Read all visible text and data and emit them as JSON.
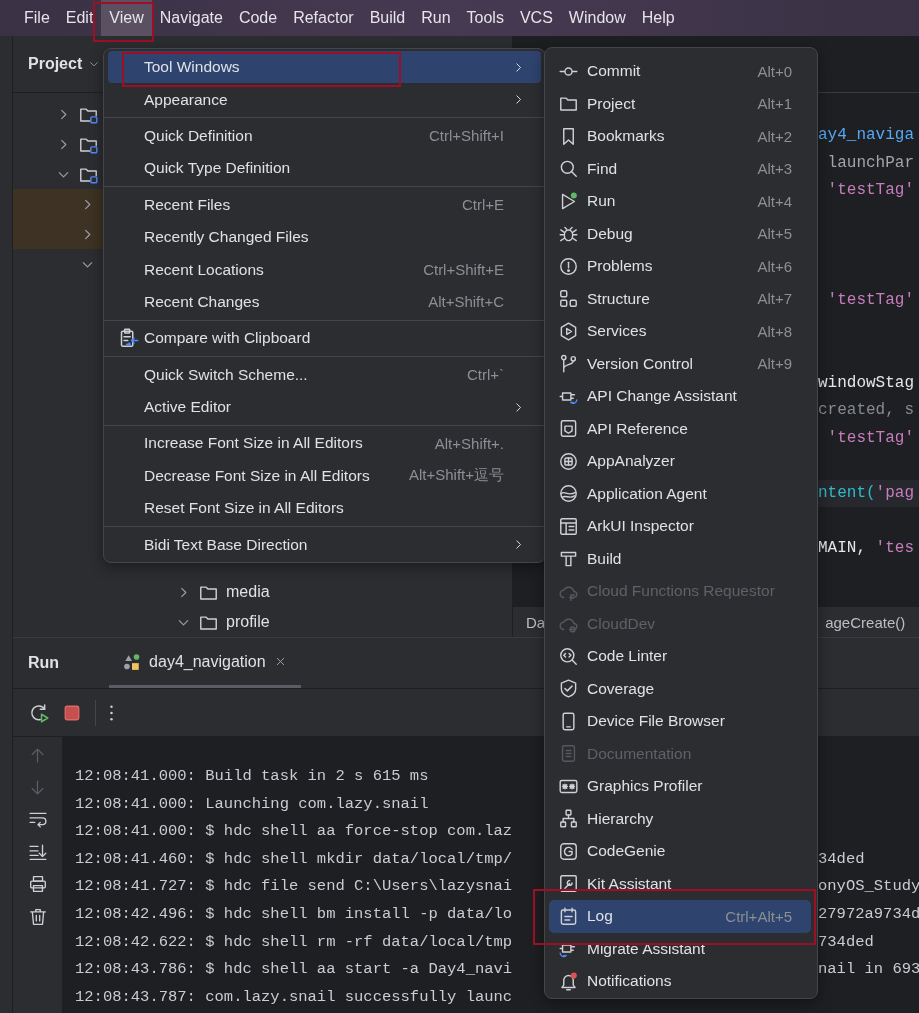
{
  "menubar": [
    {
      "label": "File",
      "selected": false,
      "outlined": false
    },
    {
      "label": "Edit",
      "selected": false,
      "outlined": false
    },
    {
      "label": "View",
      "selected": true,
      "outlined": true
    },
    {
      "label": "Navigate",
      "selected": false,
      "outlined": false
    },
    {
      "label": "Code",
      "selected": false,
      "outlined": false
    },
    {
      "label": "Refactor",
      "selected": false,
      "outlined": false
    },
    {
      "label": "Build",
      "selected": false,
      "outlined": false
    },
    {
      "label": "Run",
      "selected": false,
      "outlined": false
    },
    {
      "label": "Tools",
      "selected": false,
      "outlined": false
    },
    {
      "label": "VCS",
      "selected": false,
      "outlined": false
    },
    {
      "label": "Window",
      "selected": false,
      "outlined": false
    },
    {
      "label": "Help",
      "selected": false,
      "outlined": false
    }
  ],
  "project_panel": {
    "title": "Project",
    "tree": [
      {
        "kind": "module",
        "expanded": false,
        "highlighted": false
      },
      {
        "kind": "module",
        "expanded": false,
        "highlighted": false
      },
      {
        "kind": "module",
        "expanded": true,
        "highlighted": false,
        "children": [
          {
            "expanded": false,
            "highlighted": true
          },
          {
            "expanded": false,
            "highlighted": true
          },
          {
            "expanded": true,
            "highlighted": false,
            "children": [
              {
                "children": [
                  {
                    "children": [
                      {
                        "children": [
                          {
                            "label": "media",
                            "kind": "folder",
                            "expanded": false,
                            "highlighted": false
                          },
                          {
                            "label": "profile",
                            "kind": "folder",
                            "expanded": true,
                            "highlighted": false
                          }
                        ]
                      }
                    ]
                  }
                ]
              }
            ]
          }
        ]
      }
    ]
  },
  "editor": {
    "code_lines": [
      {
        "kind": "code",
        "highlighted": false,
        "tokens": [
          {
            "text": "ay4_naviga",
            "kind": "ident"
          }
        ]
      },
      {
        "kind": "code",
        "highlighted": false,
        "tokens": [
          {
            "text": " launchPar",
            "kind": "param"
          }
        ]
      },
      {
        "kind": "code",
        "highlighted": false,
        "tokens": [
          {
            "text": " 'testTag'",
            "kind": "string"
          }
        ]
      },
      {
        "kind": "blank",
        "highlighted": false
      },
      {
        "kind": "blank",
        "highlighted": false
      },
      {
        "kind": "blank",
        "highlighted": false
      },
      {
        "kind": "code",
        "highlighted": false,
        "tokens": [
          {
            "text": " 'testTag'",
            "kind": "string"
          }
        ]
      },
      {
        "kind": "blank",
        "highlighted": false
      },
      {
        "kind": "blank",
        "highlighted": false
      },
      {
        "kind": "code",
        "highlighted": false,
        "tokens": [
          {
            "text": "windowStag",
            "kind": "plain"
          }
        ]
      },
      {
        "kind": "code",
        "highlighted": false,
        "tokens": [
          {
            "text": "created, s",
            "kind": "muted"
          }
        ]
      },
      {
        "kind": "code",
        "highlighted": false,
        "tokens": [
          {
            "text": " 'testTag'",
            "kind": "string"
          }
        ]
      },
      {
        "kind": "blank",
        "highlighted": false
      },
      {
        "kind": "code",
        "highlighted": true,
        "tokens": [
          {
            "text": "ntent(",
            "kind": "method"
          },
          {
            "text": "'pag",
            "kind": "string"
          }
        ]
      },
      {
        "kind": "blank",
        "highlighted": false
      },
      {
        "kind": "code",
        "highlighted": false,
        "tokens": [
          {
            "text": "MAIN, ",
            "kind": "plain"
          },
          {
            "text": "'tes",
            "kind": "string"
          }
        ]
      }
    ],
    "breadcrumb": {
      "start": "Da",
      "end": "ageCreate()"
    }
  },
  "run_panel": {
    "title": "Run",
    "tabs": [
      {
        "label": "day4_navigation",
        "selected": true
      }
    ],
    "console": [
      {
        "text": "12:08:41.000: Build task in 2 s 615 ms"
      },
      {
        "text": "12:08:41.000: Launching com.lazy.snail"
      },
      {
        "text": "12:08:41.000: $ hdc shell aa force-stop com.laz"
      },
      {
        "text": "12:08:41.460: $ hdc shell mkdir data/local/tmp/",
        "tail": "34ded"
      },
      {
        "text": "12:08:41.727: $ hdc file send C:\\Users\\lazysnai",
        "tail": "onyOS_Study"
      },
      {
        "text": "12:08:42.496: $ hdc shell bm install -p data/lo",
        "tail": "27972a9734d"
      },
      {
        "text": "12:08:42.622: $ hdc shell rm -rf data/local/tmp",
        "tail": "734ded"
      },
      {
        "text": "12:08:43.786: $ hdc shell aa start -a Day4_navi",
        "tail": "nail in 693"
      },
      {
        "text": "12:08:43.787: com.lazy.snail successfully launc"
      }
    ]
  },
  "view_menu": {
    "sections": [
      {
        "items": [
          {
            "label": "Tool Windows",
            "kind": "plain",
            "submenu": true,
            "selected": true,
            "outlined": true
          },
          {
            "label": "Appearance",
            "kind": "plain",
            "submenu": true,
            "selected": false,
            "outlined": false
          }
        ]
      },
      {
        "items": [
          {
            "label": "Quick Definition",
            "kind": "plain",
            "shortcut": "Ctrl+Shift+I",
            "submenu": false,
            "selected": false,
            "outlined": false
          },
          {
            "label": "Quick Type Definition",
            "kind": "plain",
            "submenu": false,
            "selected": false,
            "outlined": false
          }
        ]
      },
      {
        "items": [
          {
            "label": "Recent Files",
            "kind": "plain",
            "shortcut": "Ctrl+E",
            "submenu": false,
            "selected": false,
            "outlined": false
          },
          {
            "label": "Recently Changed Files",
            "kind": "plain",
            "submenu": false,
            "selected": false,
            "outlined": false
          },
          {
            "label": "Recent Locations",
            "kind": "plain",
            "shortcut": "Ctrl+Shift+E",
            "submenu": false,
            "selected": false,
            "outlined": false
          },
          {
            "label": "Recent Changes",
            "kind": "plain",
            "shortcut": "Alt+Shift+C",
            "submenu": false,
            "selected": false,
            "outlined": false
          }
        ]
      },
      {
        "items": [
          {
            "label": "Compare with Clipboard",
            "kind": "with-icon",
            "submenu": false,
            "selected": false,
            "outlined": false
          }
        ]
      },
      {
        "items": [
          {
            "label": "Quick Switch Scheme...",
            "kind": "plain",
            "shortcut": "Ctrl+`",
            "submenu": false,
            "selected": false,
            "outlined": false
          },
          {
            "label": "Active Editor",
            "kind": "plain",
            "submenu": true,
            "selected": false,
            "outlined": false
          }
        ]
      },
      {
        "items": [
          {
            "label": "Increase Font Size in All Editors",
            "kind": "plain",
            "shortcut": "Alt+Shift+.",
            "submenu": false,
            "selected": false,
            "outlined": false
          },
          {
            "label": "Decrease Font Size in All Editors",
            "kind": "plain",
            "shortcut": "Alt+Shift+逗号",
            "submenu": false,
            "selected": false,
            "outlined": false
          },
          {
            "label": "Reset Font Size in All Editors",
            "kind": "plain",
            "submenu": false,
            "selected": false,
            "outlined": false
          }
        ]
      },
      {
        "items": [
          {
            "label": "Bidi Text Base Direction",
            "kind": "plain",
            "submenu": true,
            "selected": false,
            "outlined": false
          }
        ]
      }
    ]
  },
  "tool_windows_menu": {
    "items": [
      {
        "label": "Commit",
        "shortcut": "Alt+0",
        "disabled": false,
        "selected": false,
        "outlined": false
      },
      {
        "label": "Project",
        "shortcut": "Alt+1",
        "disabled": false,
        "selected": false,
        "outlined": false
      },
      {
        "label": "Bookmarks",
        "shortcut": "Alt+2",
        "disabled": false,
        "selected": false,
        "outlined": false
      },
      {
        "label": "Find",
        "shortcut": "Alt+3",
        "disabled": false,
        "selected": false,
        "outlined": false
      },
      {
        "label": "Run",
        "shortcut": "Alt+4",
        "disabled": false,
        "selected": false,
        "outlined": false
      },
      {
        "label": "Debug",
        "shortcut": "Alt+5",
        "disabled": false,
        "selected": false,
        "outlined": false
      },
      {
        "label": "Problems",
        "shortcut": "Alt+6",
        "disabled": false,
        "selected": false,
        "outlined": false
      },
      {
        "label": "Structure",
        "shortcut": "Alt+7",
        "disabled": false,
        "selected": false,
        "outlined": false
      },
      {
        "label": "Services",
        "shortcut": "Alt+8",
        "disabled": false,
        "selected": false,
        "outlined": false
      },
      {
        "label": "Version Control",
        "shortcut": "Alt+9",
        "disabled": false,
        "selected": false,
        "outlined": false
      },
      {
        "label": "API Change Assistant",
        "disabled": false,
        "selected": false,
        "outlined": false
      },
      {
        "label": "API Reference",
        "disabled": false,
        "selected": false,
        "outlined": false
      },
      {
        "label": "AppAnalyzer",
        "disabled": false,
        "selected": false,
        "outlined": false
      },
      {
        "label": "Application Agent",
        "disabled": false,
        "selected": false,
        "outlined": false
      },
      {
        "label": "ArkUI Inspector",
        "disabled": false,
        "selected": false,
        "outlined": false
      },
      {
        "label": "Build",
        "disabled": false,
        "selected": false,
        "outlined": false
      },
      {
        "label": "Cloud Functions Requestor",
        "disabled": true,
        "selected": false,
        "outlined": false
      },
      {
        "label": "CloudDev",
        "disabled": true,
        "selected": false,
        "outlined": false
      },
      {
        "label": "Code Linter",
        "disabled": false,
        "selected": false,
        "outlined": false
      },
      {
        "label": "Coverage",
        "disabled": false,
        "selected": false,
        "outlined": false
      },
      {
        "label": "Device File Browser",
        "disabled": false,
        "selected": false,
        "outlined": false
      },
      {
        "label": "Documentation",
        "disabled": true,
        "selected": false,
        "outlined": false
      },
      {
        "label": "Graphics Profiler",
        "disabled": false,
        "selected": false,
        "outlined": false
      },
      {
        "label": "Hierarchy",
        "disabled": false,
        "selected": false,
        "outlined": false
      },
      {
        "label": "CodeGenie",
        "disabled": false,
        "selected": false,
        "outlined": false
      },
      {
        "label": "Kit Assistant",
        "disabled": false,
        "selected": false,
        "outlined": false
      },
      {
        "label": "Log",
        "shortcut": "Ctrl+Alt+5",
        "disabled": false,
        "selected": true,
        "outlined": true
      },
      {
        "label": "Migrate Assistant",
        "disabled": false,
        "selected": false,
        "outlined": false
      },
      {
        "label": "Notifications",
        "disabled": false,
        "selected": false,
        "outlined": false
      }
    ]
  }
}
